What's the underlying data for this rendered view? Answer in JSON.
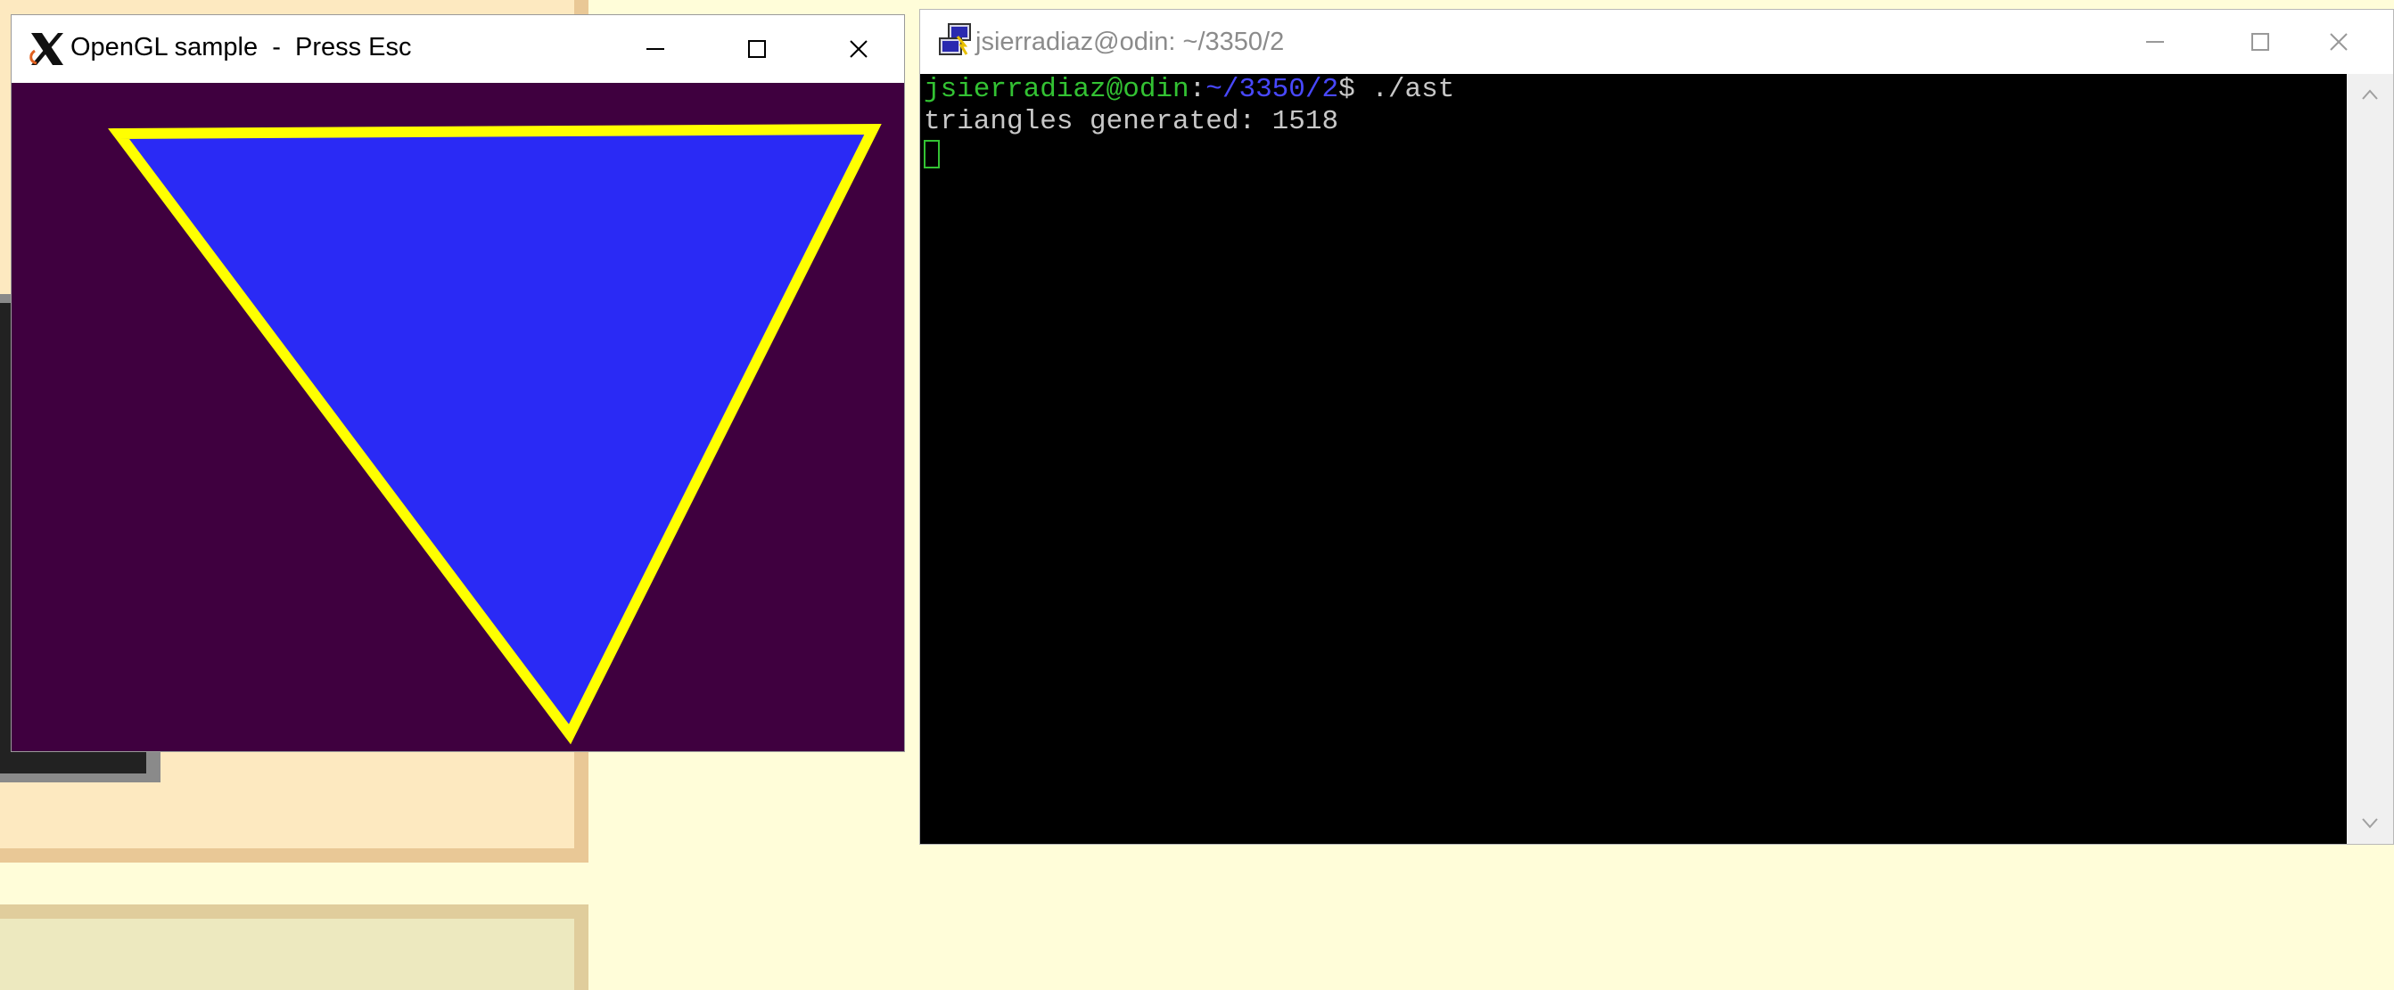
{
  "gl_window": {
    "title": "OpenGL sample  -  Press Esc",
    "app_icon": "x-window-logo-icon",
    "controls": [
      "minimize-icon",
      "maximize-icon",
      "close-icon"
    ],
    "canvas_color": "#3f003f",
    "triangle_fill": "#2a2af5",
    "triangle_outline": "#ffff00"
  },
  "terminal": {
    "title": "jsierradiaz@odin: ~/3350/2",
    "app_icon": "putty-icon",
    "controls": [
      "minimize-icon",
      "maximize-icon",
      "close-icon"
    ],
    "prompt_user": "jsierradiaz@odin",
    "prompt_colon": ":",
    "prompt_path": "~/3350/2",
    "prompt_symbol": "$ ",
    "command": "./ast",
    "output_line": "triangles generated: 1518",
    "user_color": "#33c233",
    "path_color": "#4848ff",
    "text_color": "#c8c8c8"
  },
  "desktop": {
    "background": "#fffdd9"
  }
}
